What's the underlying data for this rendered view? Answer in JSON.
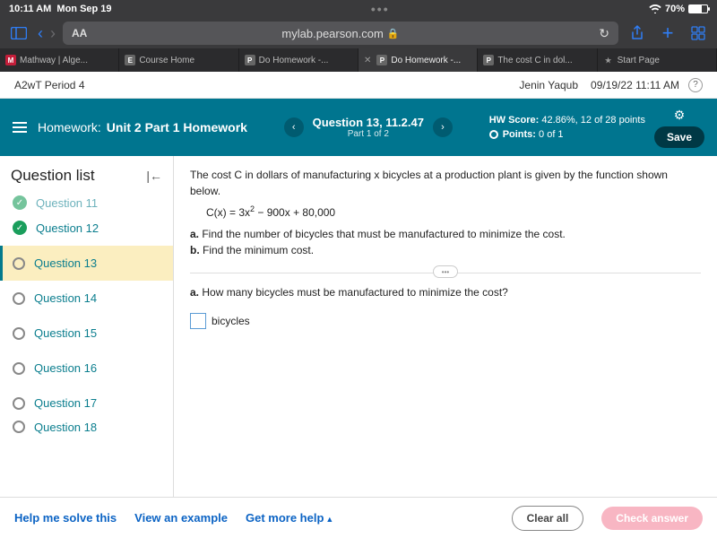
{
  "status": {
    "time": "10:11 AM",
    "date": "Mon Sep 19",
    "battery": "70%",
    "dots": "•••"
  },
  "safari": {
    "aa": "AA",
    "url": "mylab.pearson.com",
    "lock": "🔒"
  },
  "tabs": [
    {
      "icon": "M",
      "iconbg": "#c41e3a",
      "label": "Mathway | Alge..."
    },
    {
      "icon": "E",
      "iconbg": "#555",
      "label": "Course Home"
    },
    {
      "icon": "P",
      "iconbg": "#555",
      "label": "Do Homework -..."
    },
    {
      "icon": "P",
      "iconbg": "#555",
      "label": "Do Homework -...",
      "active": true,
      "close": true
    },
    {
      "icon": "P",
      "iconbg": "#555",
      "label": "The cost C in dol..."
    },
    {
      "icon": "★",
      "iconbg": "transparent",
      "label": "Start Page"
    }
  ],
  "header": {
    "period": "A2wT Period 4",
    "user": "Jenin Yaqub",
    "datetime": "09/19/22 11:11 AM"
  },
  "assign": {
    "hw_label": "Homework:",
    "hw_title": "Unit 2 Part 1 Homework",
    "qnum": "Question 13, 11.2.47",
    "qpart": "Part 1 of 2",
    "score_label": "HW Score:",
    "score_val": " 42.86%, 12 of 28 points",
    "points_label": "Points:",
    "points_val": " 0 of 1",
    "save": "Save"
  },
  "sidebar": {
    "title": "Question list",
    "items": {
      "cut": "Question 11",
      "q12": "Question 12",
      "q13": "Question 13",
      "q14": "Question 14",
      "q15": "Question 15",
      "q16": "Question 16",
      "q17": "Question 17",
      "q18": "Question 18"
    }
  },
  "problem": {
    "intro": "The cost C in dollars of manufacturing x bicycles at a production plant is given by the function shown below.",
    "formula_pre": "C(x) = 3x",
    "formula_post": " − 900x + 80,000",
    "a_label": "a.",
    "a_text": " Find the number of bicycles that must be manufactured to minimize the cost.",
    "b_label": "b.",
    "b_text": " Find the minimum cost.",
    "qa_label": "a.",
    "qa_text": " How many bicycles must be manufactured to minimize the cost?",
    "unit": "bicycles"
  },
  "footer": {
    "help": "Help me solve this",
    "example": "View an example",
    "more": "Get more help",
    "clear": "Clear all",
    "check": "Check answer"
  }
}
